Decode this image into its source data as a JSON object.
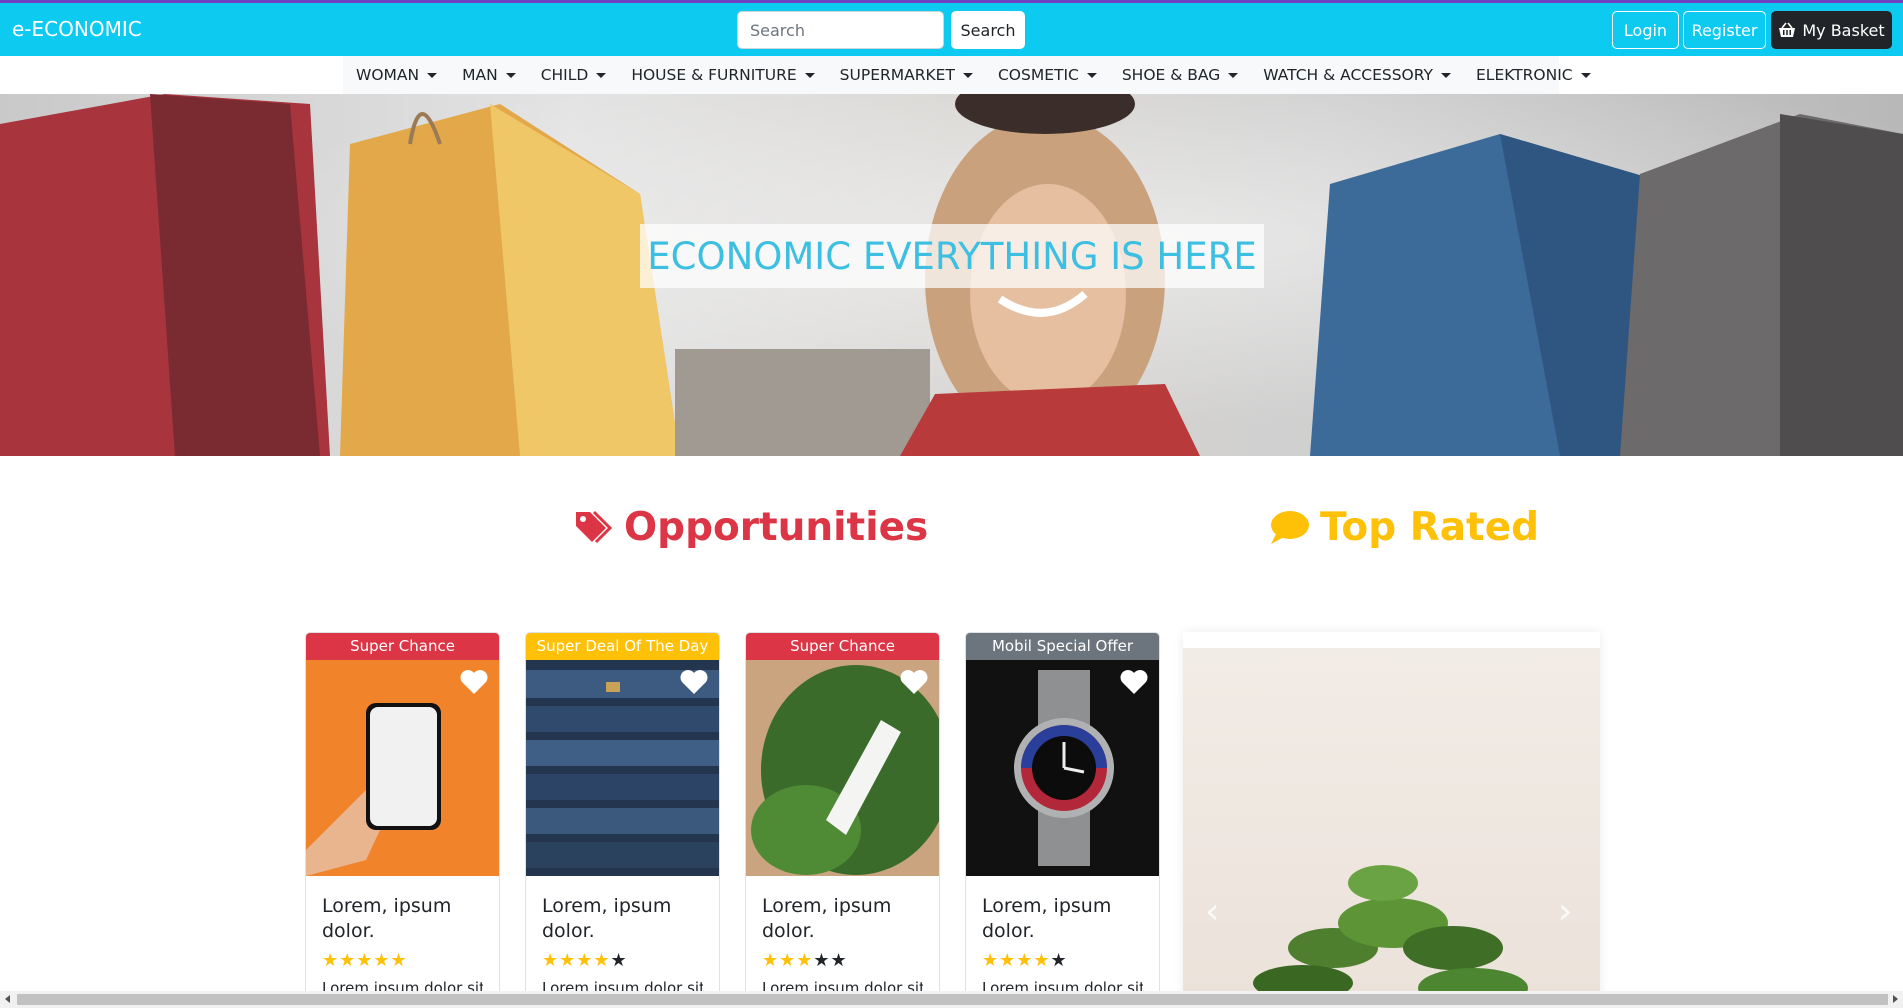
{
  "navbar": {
    "brand": "e-ECONOMIC",
    "search_placeholder": "Search",
    "search_button": "Search",
    "login": "Login",
    "register": "Register",
    "basket": "My Basket"
  },
  "categories": [
    "WOMAN",
    "MAN",
    "CHILD",
    "HOUSE & FURNITURE",
    "SUPERMARKET",
    "COSMETIC",
    "SHOE & BAG",
    "WATCH & ACCESSORY",
    "ELEKTRONIC"
  ],
  "hero": {
    "title": "ECONOMIC EVERYTHING IS HERE"
  },
  "sections": {
    "opportunities": "Opportunities",
    "top_rated": "Top Rated"
  },
  "cards": [
    {
      "badge": "Super Chance",
      "badge_color": "#dc3545",
      "name": "Lorem, ipsum dolor.",
      "rating": 5,
      "desc": "Lorem ipsum dolor sit",
      "image": "phone-in-hand"
    },
    {
      "badge": "Super Deal Of The Day",
      "badge_color": "#ffc107",
      "name": "Lorem, ipsum dolor.",
      "rating": 4,
      "desc": "Lorem ipsum dolor sit",
      "image": "stacked-jeans"
    },
    {
      "badge": "Super Chance",
      "badge_color": "#dc3545",
      "name": "Lorem, ipsum dolor.",
      "rating": 3,
      "desc": "Lorem ipsum dolor sit",
      "image": "cream-tube-on-leaves"
    },
    {
      "badge": "Mobil Special Offer",
      "badge_color": "#6c757d",
      "name": "Lorem, ipsum dolor.",
      "rating": 4,
      "desc": "Lorem ipsum dolor sit",
      "image": "wrist-watch"
    }
  ],
  "colors": {
    "primary": "#0dcaf0",
    "danger": "#dc3545",
    "warning": "#ffc107",
    "dark": "#212529"
  }
}
